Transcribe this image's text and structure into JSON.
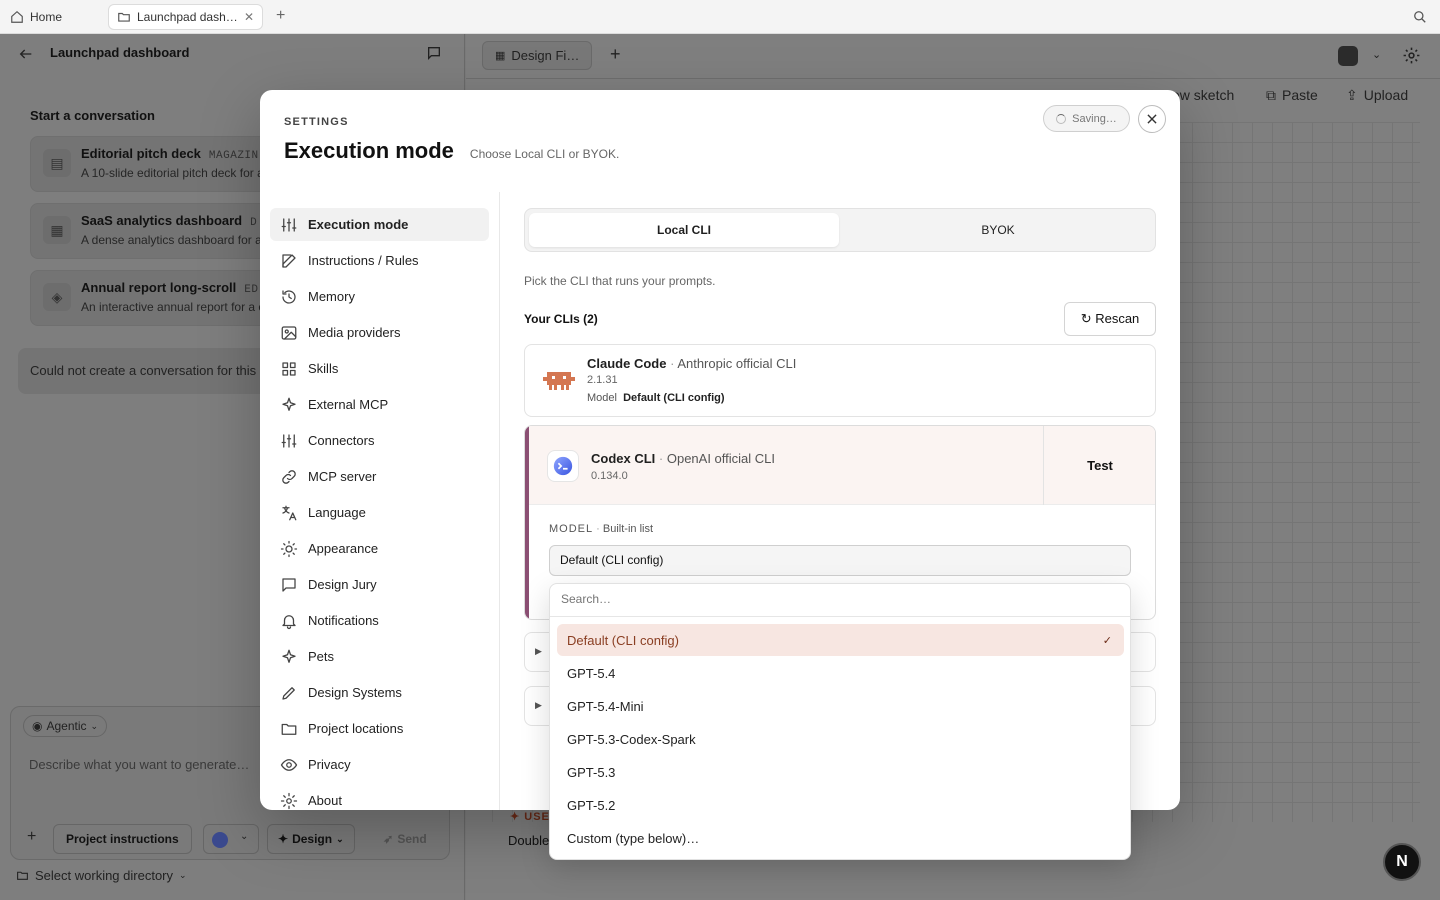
{
  "browser": {
    "home_tab": "Home",
    "active_tab": "Launchpad dash…"
  },
  "left_panel": {
    "title": "Launchpad dashboard",
    "section_heading": "Start a conversation",
    "templates": [
      {
        "title": "Editorial pitch deck",
        "tag": "MAGAZIN",
        "desc": "A 10-slide editorial pitch deck for a"
      },
      {
        "title": "SaaS analytics dashboard",
        "tag": "D",
        "desc": "A dense analytics dashboard for a"
      },
      {
        "title": "Annual report long-scroll",
        "tag": "ED",
        "desc": "An interactive annual report for a c"
      }
    ],
    "error_text": "Could not create a conversation for this",
    "composer": {
      "mode_chip": "Agentic",
      "placeholder": "Describe what you want to generate…",
      "project_instructions": "Project instructions",
      "design_button": "Design",
      "send_button": "Send",
      "working_directory": "Select working directory"
    }
  },
  "right_panel": {
    "tab_label": "Design Fi…",
    "actions": [
      "ew sketch",
      "Paste",
      "Upload"
    ],
    "use_label": "USE",
    "double_text": "Double"
  },
  "modal": {
    "eyebrow": "SETTINGS",
    "title": "Execution mode",
    "subtitle": "Choose Local CLI or BYOK.",
    "saving": "Saving…",
    "nav": [
      {
        "label": "Execution mode",
        "icon": "sliders-icon"
      },
      {
        "label": "Instructions / Rules",
        "icon": "edit-icon"
      },
      {
        "label": "Memory",
        "icon": "history-icon"
      },
      {
        "label": "Media providers",
        "icon": "image-icon"
      },
      {
        "label": "Skills",
        "icon": "grid-icon"
      },
      {
        "label": "External MCP",
        "icon": "sparkle-icon"
      },
      {
        "label": "Connectors",
        "icon": "sliders-icon"
      },
      {
        "label": "MCP server",
        "icon": "link-icon"
      },
      {
        "label": "Language",
        "icon": "translate-icon"
      },
      {
        "label": "Appearance",
        "icon": "sun-icon"
      },
      {
        "label": "Design Jury",
        "icon": "chat-icon"
      },
      {
        "label": "Notifications",
        "icon": "bell-icon"
      },
      {
        "label": "Pets",
        "icon": "sparkle-icon"
      },
      {
        "label": "Design Systems",
        "icon": "pen-icon"
      },
      {
        "label": "Project locations",
        "icon": "folder-icon"
      },
      {
        "label": "Privacy",
        "icon": "eye-icon"
      },
      {
        "label": "About",
        "icon": "gear-icon"
      }
    ],
    "segments": {
      "local": "Local CLI",
      "byok": "BYOK"
    },
    "hint": "Pick the CLI that runs your prompts.",
    "your_clis": "Your CLIs (2)",
    "rescan": "↻ Rescan",
    "clis": [
      {
        "name": "Claude Code",
        "vendor": "Anthropic official CLI",
        "version": "2.1.31",
        "model_label": "Model",
        "model_value": "Default (CLI config)"
      },
      {
        "name": "Codex CLI",
        "vendor": "OpenAI official CLI",
        "version": "0.134.0",
        "test": "Test"
      }
    ],
    "model_section": {
      "label": "MODEL",
      "source": "Built-in list",
      "value": "Default (CLI config)"
    },
    "dropdown": {
      "search_placeholder": "Search…",
      "options": [
        "Default (CLI config)",
        "GPT-5.4",
        "GPT-5.4-Mini",
        "GPT-5.3-Codex-Spark",
        "GPT-5.3",
        "GPT-5.2",
        "Custom (type below)…"
      ],
      "check": "✓"
    }
  },
  "fab": {
    "letter": "N"
  }
}
